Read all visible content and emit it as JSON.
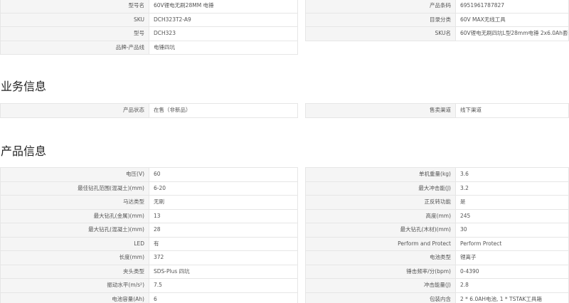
{
  "basic": {
    "left": [
      {
        "label": "型号名",
        "value": "60V锂电无刷28MM 电锤"
      },
      {
        "label": "SKU",
        "value": "DCH323T2-A9"
      },
      {
        "label": "型号",
        "value": "DCH323"
      },
      {
        "label": "品牌-产品线",
        "value": "电锤四坑"
      }
    ],
    "right": [
      {
        "label": "产品条码",
        "value": "6951961787827"
      },
      {
        "label": "目录分类",
        "value": "60V MAX无线工具"
      },
      {
        "label": "SKU名",
        "value": "60V锂电无刷四坑L型28mm电锤 2x6.0Ah套装"
      }
    ]
  },
  "business": {
    "title": "业务信息",
    "left": [
      {
        "label": "产品状态",
        "value": "在售（非新品）"
      }
    ],
    "right": [
      {
        "label": "售卖渠道",
        "value": "线下渠道"
      }
    ]
  },
  "product": {
    "title": "产品信息",
    "left": [
      {
        "label": "电压(V)",
        "value": "60"
      },
      {
        "label": "最佳钻孔范围(混凝土)(mm)",
        "value": "6-20"
      },
      {
        "label": "马达类型",
        "value": "无刷"
      },
      {
        "label": "最大钻孔(金属)(mm)",
        "value": "13"
      },
      {
        "label": "最大钻孔(混凝土)(mm)",
        "value": "28"
      },
      {
        "label": "LED",
        "value": "有"
      },
      {
        "label": "长度(mm)",
        "value": "372"
      },
      {
        "label": "夹头类型",
        "value": "SDS-Plus 四坑"
      },
      {
        "label": "振动水平(m/s²)",
        "value": "7.5"
      },
      {
        "label": "电池容量(Ah)",
        "value": "6"
      }
    ],
    "right": [
      {
        "label": "单机重量(kg)",
        "value": "3.6"
      },
      {
        "label": "最大冲击能(J)",
        "value": "3.2"
      },
      {
        "label": "正反转功能",
        "value": "是"
      },
      {
        "label": "高度(mm)",
        "value": "245"
      },
      {
        "label": "最大钻孔(木材)(mm)",
        "value": "30"
      },
      {
        "label": "Perform and Protect",
        "value": "Perform Protect"
      },
      {
        "label": "电池类型",
        "value": "锂离子"
      },
      {
        "label": "锤击频率/分(bpm)",
        "value": "0-4390"
      },
      {
        "label": "冲击能量(J)",
        "value": "2.8"
      },
      {
        "label": "包装内含",
        "value": "2 * 6.0AH电池, 1 * TSTAK工具箱"
      }
    ]
  }
}
